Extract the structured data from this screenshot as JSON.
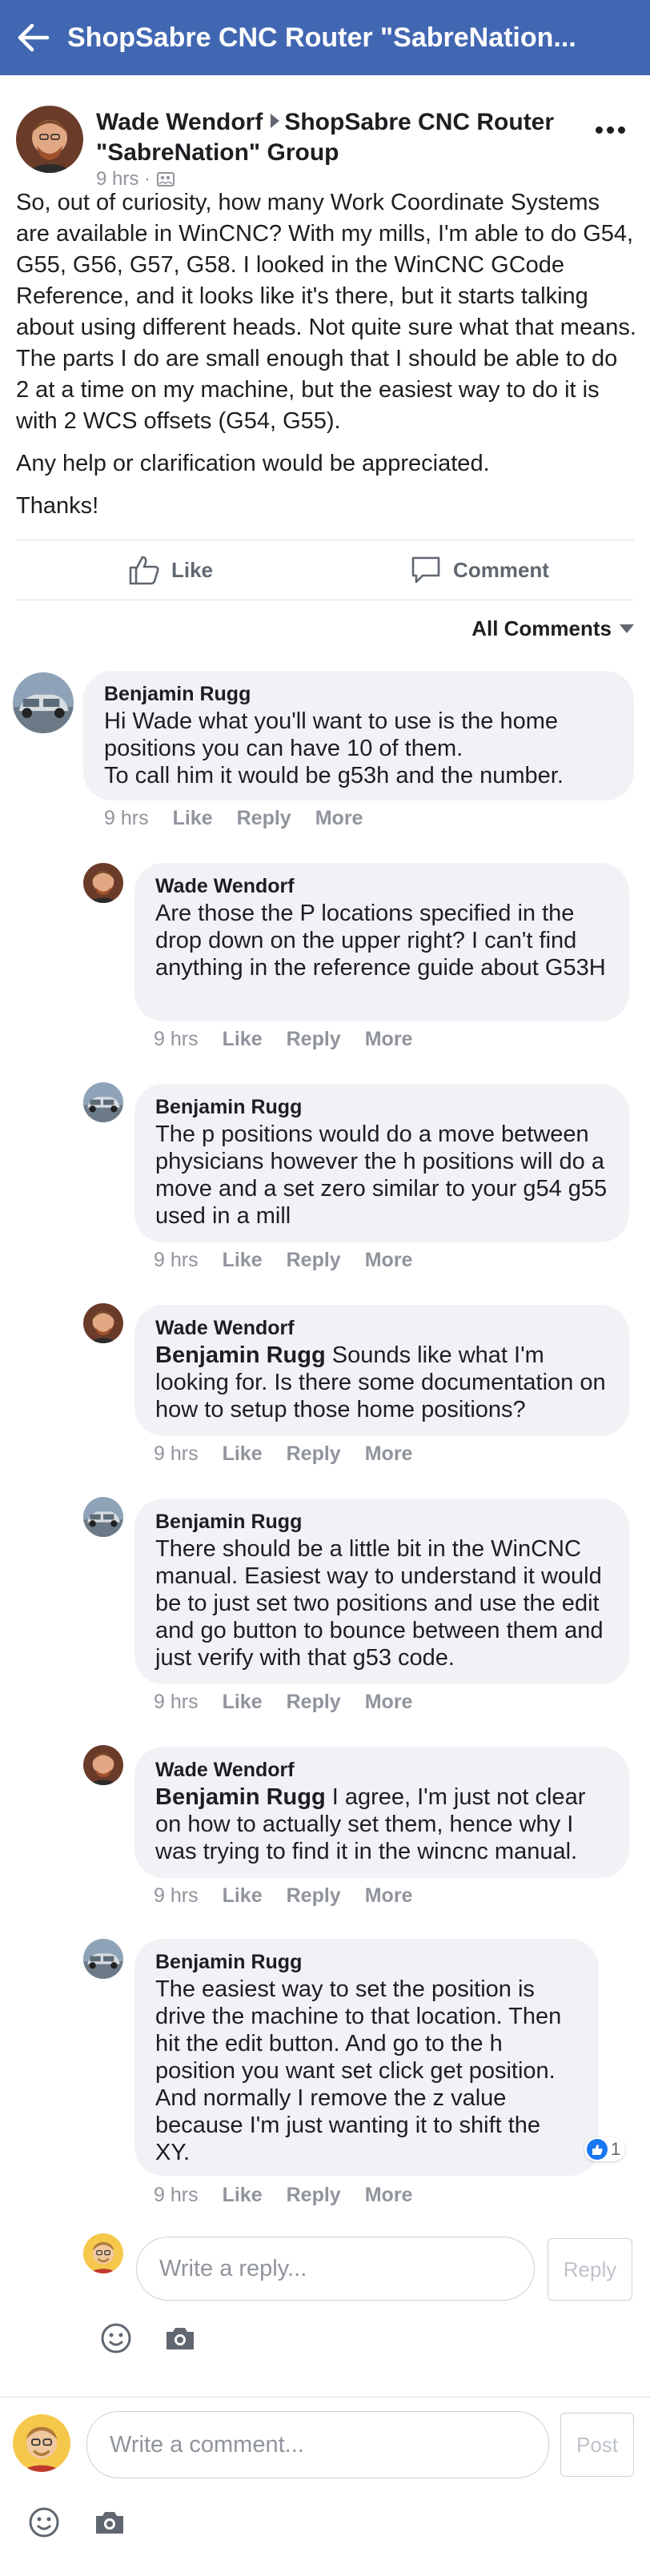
{
  "header": {
    "title": "ShopSabre CNC Router \"SabreNation..."
  },
  "post": {
    "author": "Wade Wendorf",
    "group": "ShopSabre CNC Router \"SabreNation\" Group",
    "time": "9 hrs ·",
    "paragraphs": [
      "So, out of curiosity, how many Work Coordinate Systems are available in WinCNC? With my mills, I'm able to do G54, G55, G56, G57, G58. I looked in the WinCNC GCode Reference, and it looks like it's there, but it starts talking about using different heads. Not quite sure what that means. The parts I do are small enough that I should be able to do 2 at a time on my machine, but the easiest way to do it is with 2 WCS offsets (G54, G55).",
      "Any help or clarification would be appreciated.",
      "Thanks!"
    ],
    "like_label": "Like",
    "comment_label": "Comment"
  },
  "sort_label": "All Comments",
  "comment_actions": {
    "time": "9 hrs",
    "like": "Like",
    "reply": "Reply",
    "more": "More"
  },
  "comments": [
    {
      "name": "Benjamin Rugg",
      "mention": "",
      "text": "Hi Wade what you'll want to use is the home positions you can have 10 of them.\nTo call him it would be g53h and the number."
    },
    {
      "name": "Wade Wendorf",
      "mention": "",
      "text": "Are those the P locations specified in the drop down on the upper right? I can't find anything in the reference guide about G53H"
    },
    {
      "name": "Benjamin Rugg",
      "mention": "",
      "text": "The p positions would do a move between physicians however the h positions will do a move and a set zero similar to your g54 g55 used in a mill"
    },
    {
      "name": "Wade Wendorf",
      "mention": "Benjamin Rugg",
      "text": " Sounds like what I'm looking for. Is there some documentation on how to setup those home positions?"
    },
    {
      "name": "Benjamin Rugg",
      "mention": "",
      "text": "There should be a little bit in the WinCNC manual. Easiest way to understand it would be to just set two positions and use the edit and go button to bounce between them and just verify with that g53 code."
    },
    {
      "name": "Wade Wendorf",
      "mention": "Benjamin Rugg",
      "text": " I agree, I'm just not clear on how to actually set them, hence why I was trying to find it in the wincnc manual."
    },
    {
      "name": "Benjamin Rugg",
      "mention": "",
      "text": "The easiest way to set the position is drive the machine to that location. Then hit the edit button. And go to the h position you want set click get position. And normally I remove the z value because I'm just wanting it to shift the XY.",
      "likes": "1"
    }
  ],
  "reply_composer": {
    "placeholder": "Write a reply...",
    "button": "Reply"
  },
  "comment_composer": {
    "placeholder": "Write a comment...",
    "button": "Post"
  },
  "colors": {
    "brand": "#4267b2",
    "bubble": "#f0f2f5",
    "meta": "#90949c",
    "like_blue": "#1877f2"
  },
  "icons": [
    "back-arrow-icon",
    "privacy-icon",
    "more-icon",
    "like-icon",
    "comment-icon",
    "dropdown-caret-icon",
    "emoji-icon",
    "camera-icon"
  ]
}
